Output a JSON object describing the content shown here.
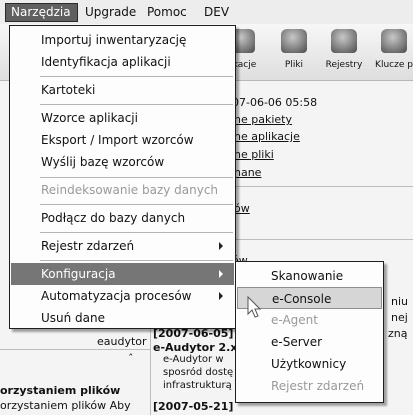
{
  "menubar": {
    "items": [
      {
        "label": "Narzędzia"
      },
      {
        "label": "Upgrade"
      },
      {
        "label": "Pomoc"
      },
      {
        "label": "DEV"
      }
    ]
  },
  "toolbar": {
    "items": [
      {
        "label": "likacje",
        "icon": "applications-icon"
      },
      {
        "label": "Pliki",
        "icon": "files-icon"
      },
      {
        "label": "Rejestry",
        "icon": "registry-icon"
      },
      {
        "label": "Klucze p",
        "icon": "keys-icon"
      }
    ]
  },
  "background": {
    "timestamp": "07-06-06 05:58",
    "links": [
      "ne pakiety",
      "ne aplikacje",
      "ne pliki",
      "nane"
    ],
    "short_link": "ów",
    "short_text": "ów",
    "eaudytor_label": "eaudytor",
    "news": [
      {
        "date": "[2007-06-05]",
        "title": "e-Audytor 2.x",
        "lines": [
          "e-Audytor w",
          "sposród dostę",
          "infrastrukturą I"
        ]
      },
      {
        "date": "[2007-05-21]"
      }
    ],
    "right_fragments": [
      "niu",
      "nej",
      "zną"
    ],
    "bottom_heading": "orzystaniem plików",
    "bottom_text": "orzystaniem   plików   Aby"
  },
  "menu_main": {
    "items": [
      {
        "label": "Importuj inwentaryzację",
        "state": "normal"
      },
      {
        "label": "Identyfikacja aplikacji",
        "state": "normal"
      },
      {
        "label": "Kartoteki",
        "state": "normal"
      },
      {
        "label": "Wzorce aplikacji",
        "state": "normal"
      },
      {
        "label": "Eksport / Import wzorców",
        "state": "normal"
      },
      {
        "label": "Wyślij bazę wzorców",
        "state": "normal"
      },
      {
        "label": "Reindeksowanie bazy danych",
        "state": "disabled"
      },
      {
        "label": "Podłącz do bazy danych",
        "state": "normal"
      },
      {
        "label": "Rejestr zdarzeń",
        "state": "submenu"
      },
      {
        "label": "Konfiguracja",
        "state": "active-submenu"
      },
      {
        "label": "Automatyzacja procesów",
        "state": "submenu"
      },
      {
        "label": "Usuń dane",
        "state": "normal"
      }
    ]
  },
  "menu_config": {
    "items": [
      {
        "label": "Skanowanie",
        "state": "normal"
      },
      {
        "label": "e-Console",
        "state": "hover"
      },
      {
        "label": "e-Agent",
        "state": "disabled"
      },
      {
        "label": "e-Server",
        "state": "normal"
      },
      {
        "label": "Użytkownicy",
        "state": "normal"
      },
      {
        "label": "Rejestr zdarzeń",
        "state": "disabled"
      }
    ]
  },
  "colors": {
    "menu_highlight": "#767676",
    "menubar_active": "#606060",
    "submenu_hover": "#d6d6d6",
    "disabled_text": "#999999"
  }
}
